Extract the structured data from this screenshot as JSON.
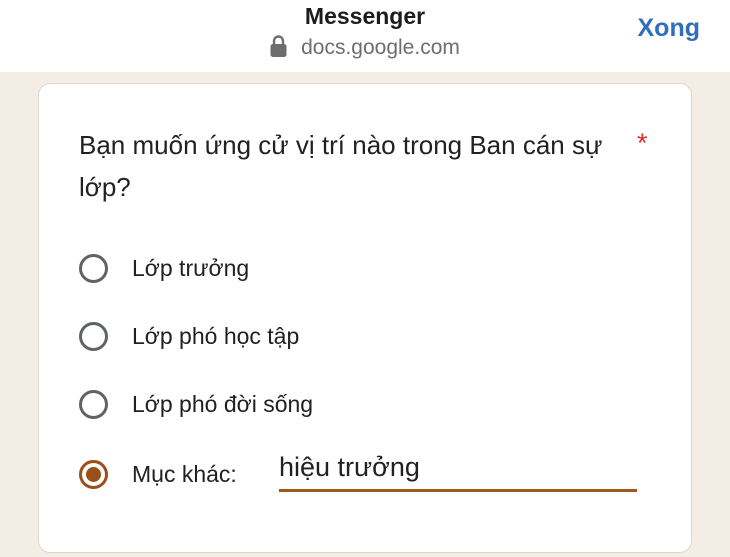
{
  "header": {
    "app_title": "Messenger",
    "url": "docs.google.com",
    "done_label": "Xong",
    "lock_icon": "lock-icon"
  },
  "colors": {
    "accent": "#9b4f1b",
    "link": "#2f6dbf",
    "required": "#d93025",
    "page_bg": "#f3ede6"
  },
  "form": {
    "question": "Bạn muốn ứng cử vị trí nào trong Ban cán sự lớp?",
    "required_mark": "*",
    "options": [
      {
        "label": "Lớp trưởng",
        "selected": false
      },
      {
        "label": "Lớp phó học tập",
        "selected": false
      },
      {
        "label": "Lớp phó đời sống",
        "selected": false
      },
      {
        "label": "Mục khác:",
        "selected": true
      }
    ],
    "other_value": "hiệu trưởng"
  }
}
